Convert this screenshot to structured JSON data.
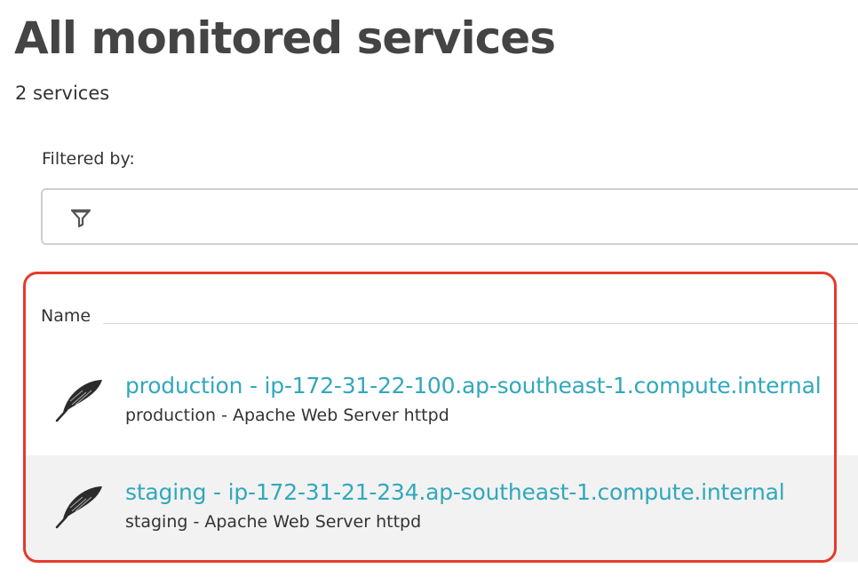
{
  "page": {
    "title": "All monitored services",
    "count_text": "2 services"
  },
  "filter": {
    "label": "Filtered by:",
    "value": "",
    "icon": "filter-icon"
  },
  "table": {
    "columns": [
      "Name"
    ],
    "rows": [
      {
        "name": "production - ip-172-31-22-100.ap-southeast-1.compute.internal",
        "subtitle": "production - Apache Web Server httpd",
        "icon": "apache-feather-icon"
      },
      {
        "name": "staging - ip-172-31-21-234.ap-southeast-1.compute.internal",
        "subtitle": "staging - Apache Web Server httpd",
        "icon": "apache-feather-icon"
      }
    ]
  },
  "colors": {
    "link": "#31a8bc",
    "highlight": "#e53a2b",
    "alt_row": "#f2f2f2"
  }
}
